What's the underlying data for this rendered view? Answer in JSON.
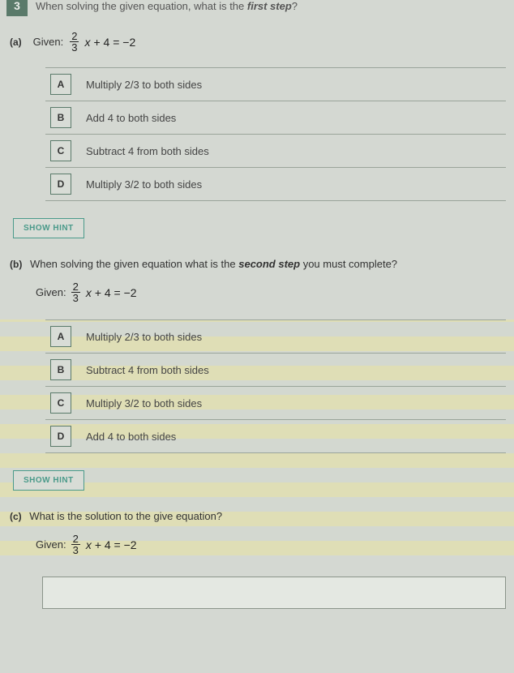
{
  "question": {
    "number": "3",
    "prompt_prefix": "When solving the given equation, what is the ",
    "prompt_emph": "first step",
    "prompt_suffix": "?"
  },
  "given_label": "Given:",
  "equation": {
    "frac_num": "2",
    "frac_den": "3",
    "var": "x",
    "rest": " + 4 = −2"
  },
  "part_a": {
    "label": "(a)",
    "options": [
      {
        "letter": "A",
        "text": "Multiply 2/3 to both sides"
      },
      {
        "letter": "B",
        "text": "Add 4 to both sides"
      },
      {
        "letter": "C",
        "text": "Subtract 4 from both sides"
      },
      {
        "letter": "D",
        "text": "Multiply 3/2 to both sides"
      }
    ]
  },
  "part_b": {
    "label": "(b)",
    "prompt_prefix": "When solving the given equation what is the ",
    "prompt_emph": "second step",
    "prompt_suffix": " you must complete?",
    "options": [
      {
        "letter": "A",
        "text": "Multiply 2/3 to both sides"
      },
      {
        "letter": "B",
        "text": "Subtract 4 from both sides"
      },
      {
        "letter": "C",
        "text": "Multiply 3/2 to both sides"
      },
      {
        "letter": "D",
        "text": "Add 4 to both sides"
      }
    ]
  },
  "part_c": {
    "label": "(c)",
    "prompt": "What is the solution to the give equation?"
  },
  "hint_label": "SHOW HINT"
}
